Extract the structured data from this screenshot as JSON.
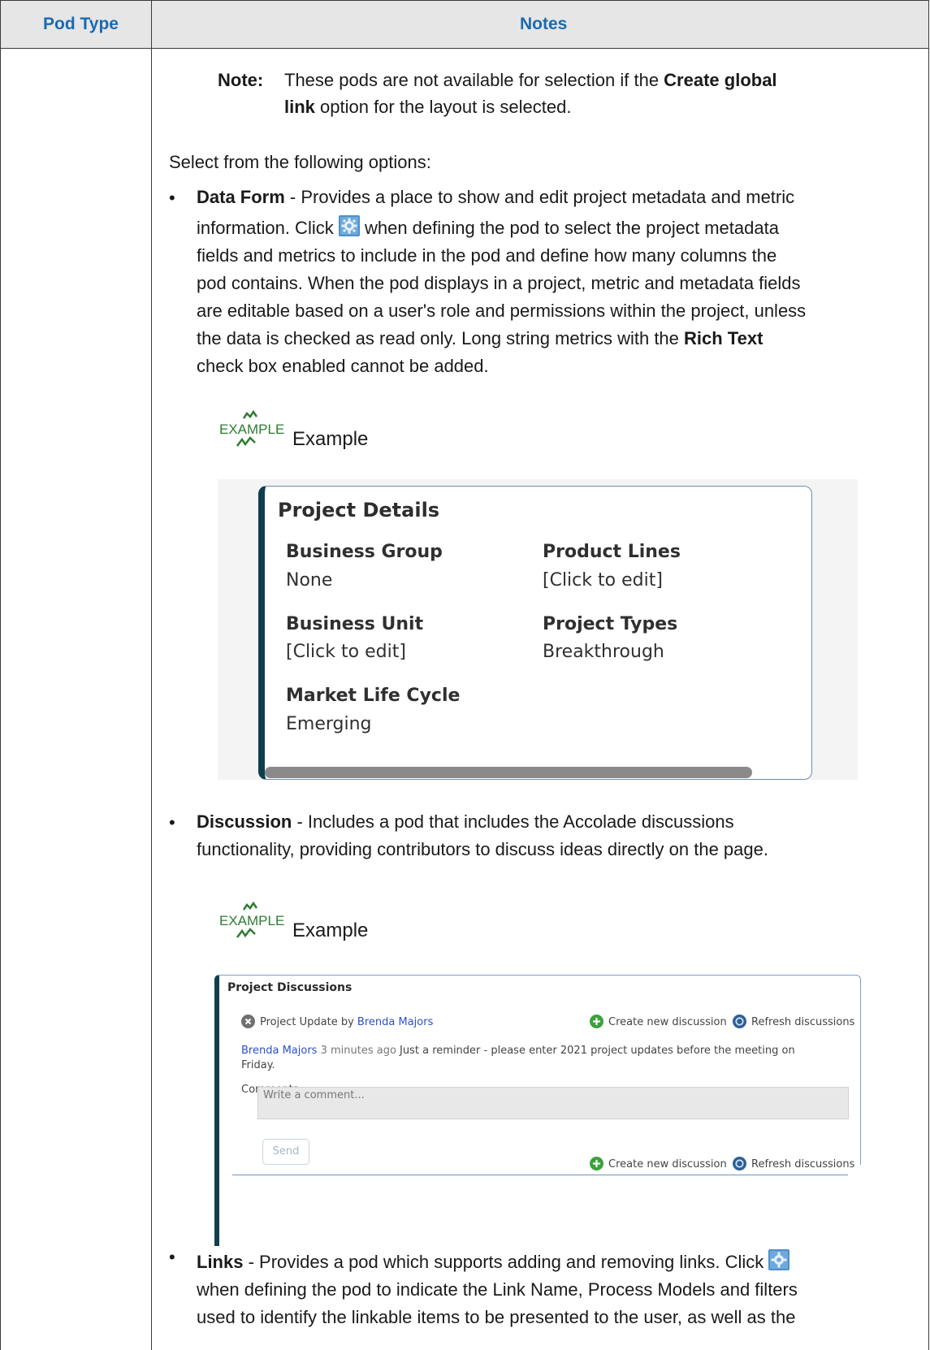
{
  "table": {
    "headers": {
      "col1": "Pod Type",
      "col2": "Notes"
    }
  },
  "note": {
    "label": "Note:",
    "text_line1_part1": "These pods are not available for selection if the ",
    "text_line1_bold": "Create global",
    "text_line2_bold": "link",
    "text_line2_part2": " option for the layout is selected."
  },
  "intro": "Select from the following options:",
  "data_form": {
    "term": "Data Form",
    "lines": [
      " - Provides a place to show and edit project metadata and metric",
      "information. Click",
      " when defining the pod to select the project metadata",
      "fields and metrics to include in the pod and define how many columns the",
      "pod contains. When the pod displays in a project, metric and metadata fields",
      "are editable based on a user's role and permissions within the project, unless",
      "the data is checked as read only. Long string metrics with the ",
      "Rich Text",
      "check box enabled cannot be added."
    ],
    "gear_icon": "settings-gear-icon"
  },
  "example_label": "Example",
  "example_icon_text": "EXAMPLE",
  "project_details": {
    "title": "Project Details",
    "fields": [
      {
        "label": "Business Group",
        "value": "None"
      },
      {
        "label": "Product Lines",
        "value": "[Click to edit]"
      },
      {
        "label": "Business Unit",
        "value": "[Click to edit]"
      },
      {
        "label": "Project Types",
        "value": "Breakthrough"
      },
      {
        "label": "Market Life Cycle",
        "value": "Emerging"
      }
    ]
  },
  "discussion": {
    "term": "Discussion",
    "line1": " - Includes a pod that includes the Accolade discussions",
    "line2": "functionality, providing contributors to discuss ideas directly on the page."
  },
  "project_discussions": {
    "title": "Project Discussions",
    "topic_prefix": "Project Update by ",
    "topic_author": "Brenda Majors",
    "create_label": "Create new discussion",
    "refresh_label": "Refresh discussions",
    "post_author": "Brenda Majors",
    "post_time": " 3 minutes ago ",
    "post_text_line1": "Just a reminder - please enter 2021 project updates before the meeting on",
    "post_text_line2": "Friday.",
    "comments_label": "Comments",
    "comment_placeholder": "Write a comment...",
    "send_label": "Send"
  },
  "links": {
    "term": "Links",
    "line1": " - Provides a pod which supports adding and removing links. Click",
    "line2": "when defining the pod to indicate the Link Name, Process Models and filters",
    "line3": "used to identify the linkable items to be presented to the user, as well as the"
  },
  "colors": {
    "header_text": "#1b6aaf",
    "header_bg": "#e6e6e6",
    "pod_accent": "#0f3f4e",
    "link_blue": "#2b50c8",
    "example_green": "#2e7d32"
  }
}
